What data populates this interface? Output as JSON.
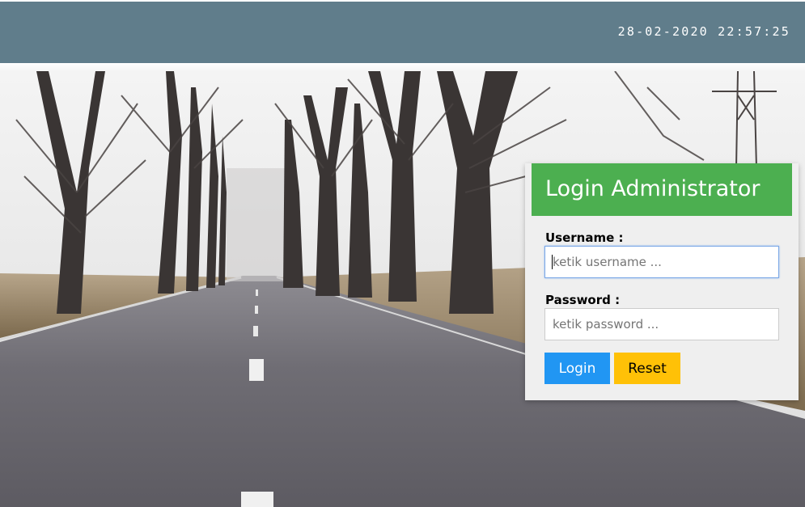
{
  "header": {
    "datetime": "28-02-2020 22:57:25"
  },
  "background": {
    "description_icon": "road-landscape-image"
  },
  "login": {
    "title": "Login Administrator",
    "username_label": "Username :",
    "username_placeholder": "ketik username ...",
    "password_label": "Password :",
    "password_placeholder": "ketik password ...",
    "login_button": "Login",
    "reset_button": "Reset"
  },
  "colors": {
    "header": "#607d8b",
    "login_header": "#4caf50",
    "login_button": "#2196f3",
    "reset_button": "#ffc107"
  }
}
